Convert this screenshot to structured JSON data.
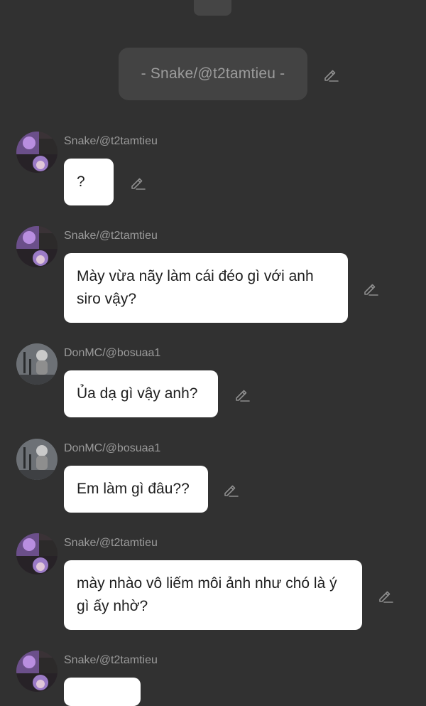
{
  "header": {
    "title": "- Snake/@t2tamtieu -",
    "edit_icon": "pencil-edit-icon"
  },
  "colors": {
    "background": "#313131",
    "header_pill": "#434343",
    "bubble": "#ffffff",
    "username": "#9a9a9a"
  },
  "messages": [
    {
      "author": "Snake/@t2tamtieu",
      "avatar": "purple-hair-avatar",
      "text": "?"
    },
    {
      "author": "Snake/@t2tamtieu",
      "avatar": "purple-hair-avatar",
      "text": "Mày vừa nãy làm cái đéo gì với anh siro vậy?"
    },
    {
      "author": "DonMC/@bosuaa1",
      "avatar": "stage-performer-avatar",
      "text": "Ủa dạ gì vậy anh?"
    },
    {
      "author": "DonMC/@bosuaa1",
      "avatar": "stage-performer-avatar",
      "text": "Em làm gì đâu??"
    },
    {
      "author": "Snake/@t2tamtieu",
      "avatar": "purple-hair-avatar",
      "text": "mày nhào vô liếm môi ảnh như chó là ý gì ấy nhờ?"
    },
    {
      "author": "Snake/@t2tamtieu",
      "avatar": "purple-hair-avatar",
      "text": ""
    }
  ]
}
